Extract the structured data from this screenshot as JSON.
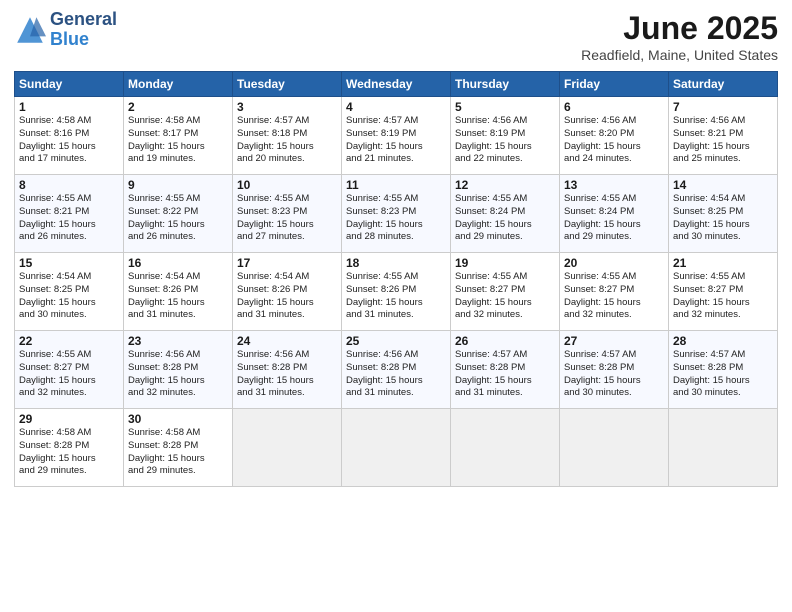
{
  "header": {
    "logo_general": "General",
    "logo_blue": "Blue",
    "month_title": "June 2025",
    "location": "Readfield, Maine, United States"
  },
  "weekdays": [
    "Sunday",
    "Monday",
    "Tuesday",
    "Wednesday",
    "Thursday",
    "Friday",
    "Saturday"
  ],
  "weeks": [
    [
      {
        "day": "1",
        "info": "Sunrise: 4:58 AM\nSunset: 8:16 PM\nDaylight: 15 hours\nand 17 minutes."
      },
      {
        "day": "2",
        "info": "Sunrise: 4:58 AM\nSunset: 8:17 PM\nDaylight: 15 hours\nand 19 minutes."
      },
      {
        "day": "3",
        "info": "Sunrise: 4:57 AM\nSunset: 8:18 PM\nDaylight: 15 hours\nand 20 minutes."
      },
      {
        "day": "4",
        "info": "Sunrise: 4:57 AM\nSunset: 8:19 PM\nDaylight: 15 hours\nand 21 minutes."
      },
      {
        "day": "5",
        "info": "Sunrise: 4:56 AM\nSunset: 8:19 PM\nDaylight: 15 hours\nand 22 minutes."
      },
      {
        "day": "6",
        "info": "Sunrise: 4:56 AM\nSunset: 8:20 PM\nDaylight: 15 hours\nand 24 minutes."
      },
      {
        "day": "7",
        "info": "Sunrise: 4:56 AM\nSunset: 8:21 PM\nDaylight: 15 hours\nand 25 minutes."
      }
    ],
    [
      {
        "day": "8",
        "info": "Sunrise: 4:55 AM\nSunset: 8:21 PM\nDaylight: 15 hours\nand 26 minutes."
      },
      {
        "day": "9",
        "info": "Sunrise: 4:55 AM\nSunset: 8:22 PM\nDaylight: 15 hours\nand 26 minutes."
      },
      {
        "day": "10",
        "info": "Sunrise: 4:55 AM\nSunset: 8:23 PM\nDaylight: 15 hours\nand 27 minutes."
      },
      {
        "day": "11",
        "info": "Sunrise: 4:55 AM\nSunset: 8:23 PM\nDaylight: 15 hours\nand 28 minutes."
      },
      {
        "day": "12",
        "info": "Sunrise: 4:55 AM\nSunset: 8:24 PM\nDaylight: 15 hours\nand 29 minutes."
      },
      {
        "day": "13",
        "info": "Sunrise: 4:55 AM\nSunset: 8:24 PM\nDaylight: 15 hours\nand 29 minutes."
      },
      {
        "day": "14",
        "info": "Sunrise: 4:54 AM\nSunset: 8:25 PM\nDaylight: 15 hours\nand 30 minutes."
      }
    ],
    [
      {
        "day": "15",
        "info": "Sunrise: 4:54 AM\nSunset: 8:25 PM\nDaylight: 15 hours\nand 30 minutes."
      },
      {
        "day": "16",
        "info": "Sunrise: 4:54 AM\nSunset: 8:26 PM\nDaylight: 15 hours\nand 31 minutes."
      },
      {
        "day": "17",
        "info": "Sunrise: 4:54 AM\nSunset: 8:26 PM\nDaylight: 15 hours\nand 31 minutes."
      },
      {
        "day": "18",
        "info": "Sunrise: 4:55 AM\nSunset: 8:26 PM\nDaylight: 15 hours\nand 31 minutes."
      },
      {
        "day": "19",
        "info": "Sunrise: 4:55 AM\nSunset: 8:27 PM\nDaylight: 15 hours\nand 32 minutes."
      },
      {
        "day": "20",
        "info": "Sunrise: 4:55 AM\nSunset: 8:27 PM\nDaylight: 15 hours\nand 32 minutes."
      },
      {
        "day": "21",
        "info": "Sunrise: 4:55 AM\nSunset: 8:27 PM\nDaylight: 15 hours\nand 32 minutes."
      }
    ],
    [
      {
        "day": "22",
        "info": "Sunrise: 4:55 AM\nSunset: 8:27 PM\nDaylight: 15 hours\nand 32 minutes."
      },
      {
        "day": "23",
        "info": "Sunrise: 4:56 AM\nSunset: 8:28 PM\nDaylight: 15 hours\nand 32 minutes."
      },
      {
        "day": "24",
        "info": "Sunrise: 4:56 AM\nSunset: 8:28 PM\nDaylight: 15 hours\nand 31 minutes."
      },
      {
        "day": "25",
        "info": "Sunrise: 4:56 AM\nSunset: 8:28 PM\nDaylight: 15 hours\nand 31 minutes."
      },
      {
        "day": "26",
        "info": "Sunrise: 4:57 AM\nSunset: 8:28 PM\nDaylight: 15 hours\nand 31 minutes."
      },
      {
        "day": "27",
        "info": "Sunrise: 4:57 AM\nSunset: 8:28 PM\nDaylight: 15 hours\nand 30 minutes."
      },
      {
        "day": "28",
        "info": "Sunrise: 4:57 AM\nSunset: 8:28 PM\nDaylight: 15 hours\nand 30 minutes."
      }
    ],
    [
      {
        "day": "29",
        "info": "Sunrise: 4:58 AM\nSunset: 8:28 PM\nDaylight: 15 hours\nand 29 minutes."
      },
      {
        "day": "30",
        "info": "Sunrise: 4:58 AM\nSunset: 8:28 PM\nDaylight: 15 hours\nand 29 minutes."
      },
      {
        "day": "",
        "info": ""
      },
      {
        "day": "",
        "info": ""
      },
      {
        "day": "",
        "info": ""
      },
      {
        "day": "",
        "info": ""
      },
      {
        "day": "",
        "info": ""
      }
    ]
  ]
}
